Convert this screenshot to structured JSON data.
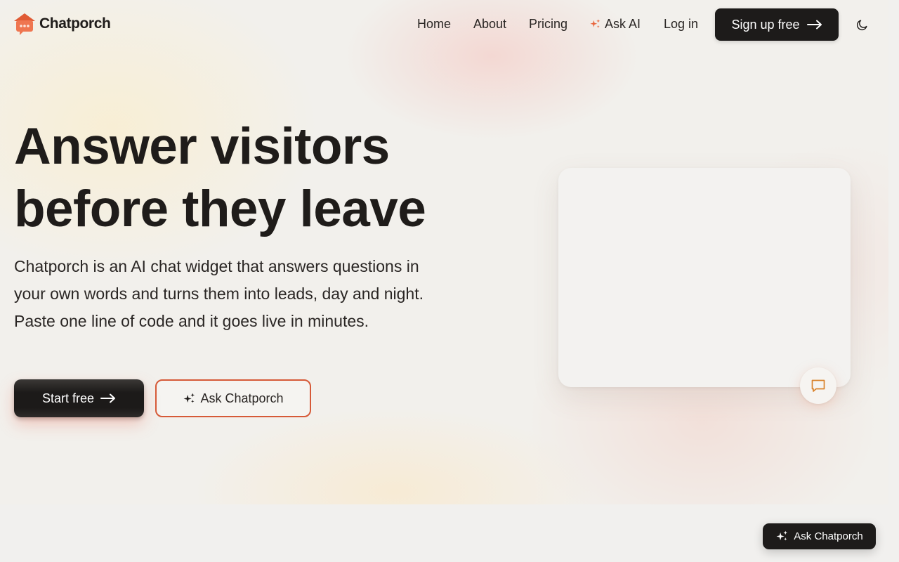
{
  "brand": {
    "name": "Chatporch",
    "accent": "#e8643c"
  },
  "nav": {
    "links": [
      "Home",
      "About",
      "Pricing",
      "Ask AI",
      "Log in"
    ],
    "signup_label": "Sign up free",
    "theme_icon": "moon-icon"
  },
  "hero": {
    "headline_line1": "Answer visitors",
    "headline_line2": "before they leave",
    "subhead": "Chatporch is an AI chat widget that answers questions in your own words and turns them into leads, day and night. Paste one line of code and it goes live in minutes.",
    "primary_cta": "Start free",
    "secondary_cta": "Ask Chatporch"
  },
  "widget": {
    "launcher_icon": "chat-bubble-icon",
    "floating_label": "Ask Chatporch"
  },
  "colors": {
    "dark_button": "#1d1b1a",
    "outline_accent": "#d65a38",
    "chat_icon": "#d9822b"
  }
}
